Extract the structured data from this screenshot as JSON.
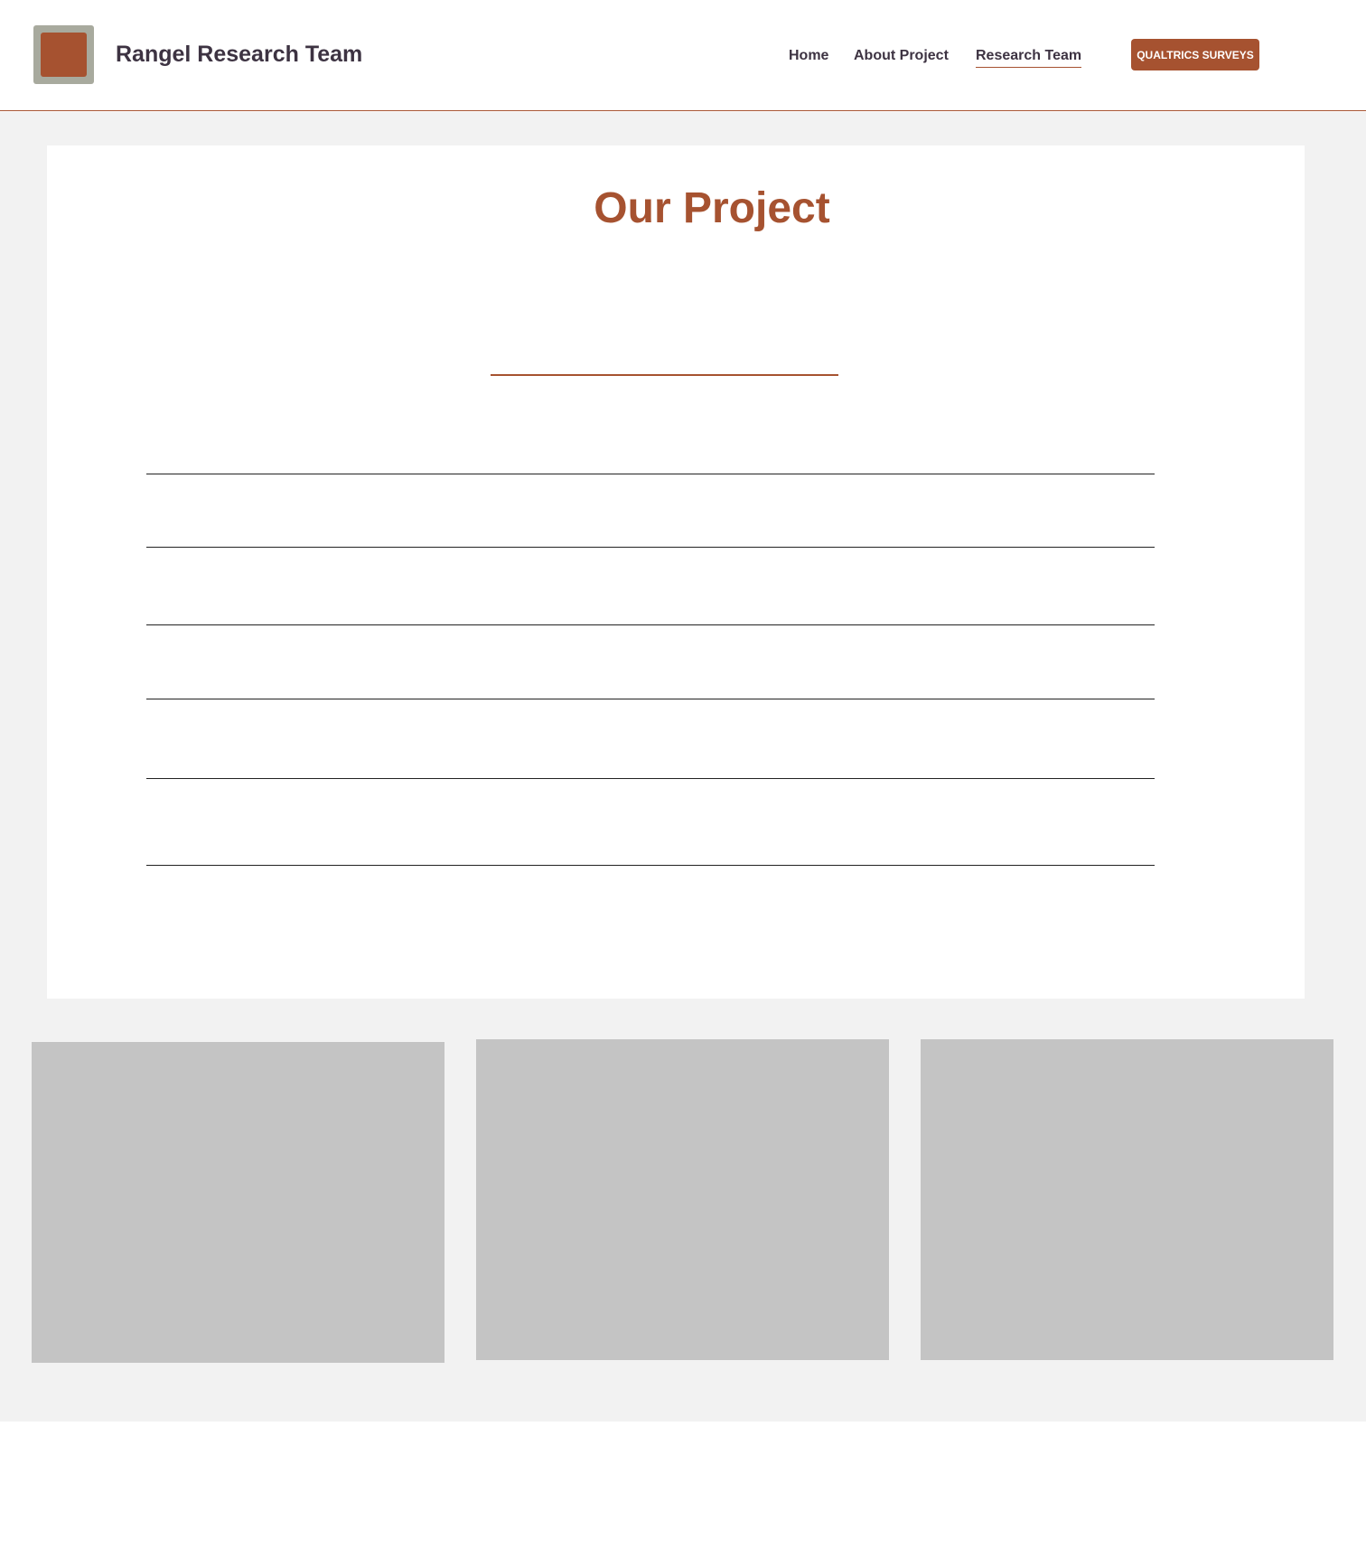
{
  "header": {
    "logo_icon": "square-logo-icon",
    "site_title": "Rangel Research Team",
    "nav": {
      "home": "Home",
      "about": "About Project",
      "team": "Research Team"
    },
    "cta_label": "QUALTRICS SURVEYS"
  },
  "main": {
    "title": "Our Project"
  },
  "colors": {
    "accent": "#a65230",
    "text": "#3d3342",
    "band": "#f2f2f2",
    "placeholder": "#c4c4c4"
  }
}
